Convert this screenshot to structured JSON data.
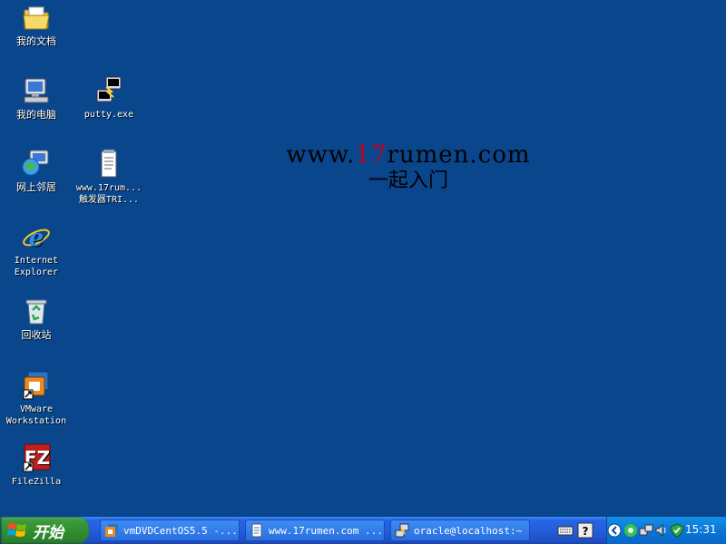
{
  "desktop": {
    "icons": [
      {
        "label": "我的文档"
      },
      {
        "label": "我的电脑"
      },
      {
        "label": "网上邻居"
      },
      {
        "label": "Internet\nExplorer"
      },
      {
        "label": "回收站"
      },
      {
        "label": "VMware\nWorkstation"
      },
      {
        "label": "FileZilla"
      },
      {
        "label": "putty.exe"
      },
      {
        "label": "www.17rum...\n触发器TRI..."
      }
    ]
  },
  "watermark": {
    "url_prefix": "www.",
    "url_highlight": "17",
    "url_suffix": "rumen.com",
    "chinese": "一起入门",
    "highlight_color": "#c0001a"
  },
  "taskbar": {
    "start_label": "开始",
    "tasks": [
      {
        "label": "vmDVDCentOS5.5 -..."
      },
      {
        "label": "www.17rumen.com ..."
      },
      {
        "label": "oracle@localhost:~"
      }
    ],
    "clock": "15:31"
  },
  "colors": {
    "desktop": "#0a468c",
    "taskbar": "#245edb",
    "start": "#3c9a3c",
    "tray": "#0b77d8"
  }
}
